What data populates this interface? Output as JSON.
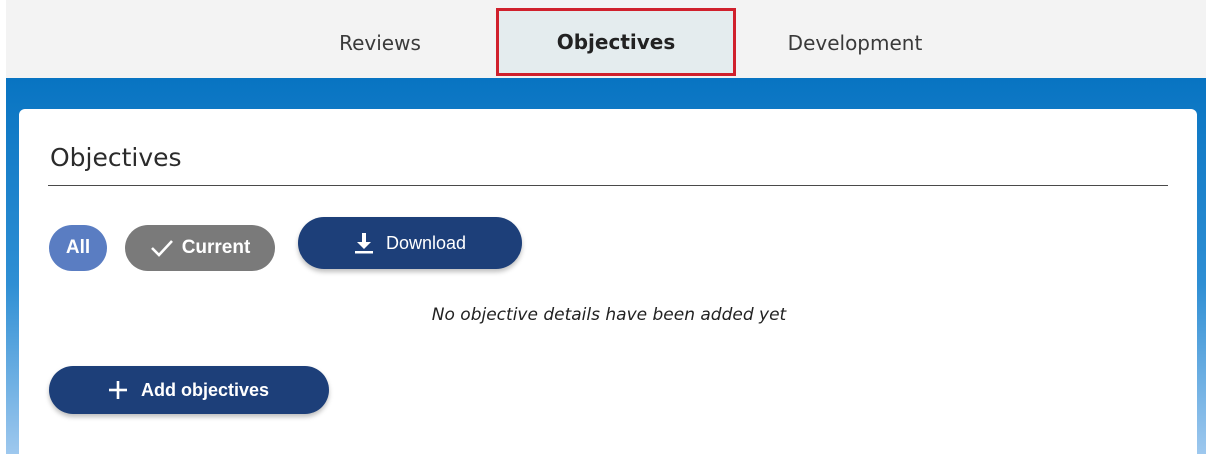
{
  "tabs": [
    {
      "label": "Reviews",
      "active": false
    },
    {
      "label": "Objectives",
      "active": true
    },
    {
      "label": "Development",
      "active": false
    }
  ],
  "card": {
    "title": "Objectives",
    "filters": {
      "all_label": "All",
      "current_label": "Current"
    },
    "download_label": "Download",
    "empty_message": "No objective details have been added yet",
    "add_label": "Add objectives"
  },
  "colors": {
    "banner_blue": "#0874c2",
    "primary_button": "#1d3f79",
    "filter_all": "#5a7dc2",
    "filter_current": "#7a7a7a",
    "highlight_border": "#d0202c"
  },
  "icons": {
    "current": "check-icon",
    "download": "download-icon",
    "add": "plus-icon"
  }
}
